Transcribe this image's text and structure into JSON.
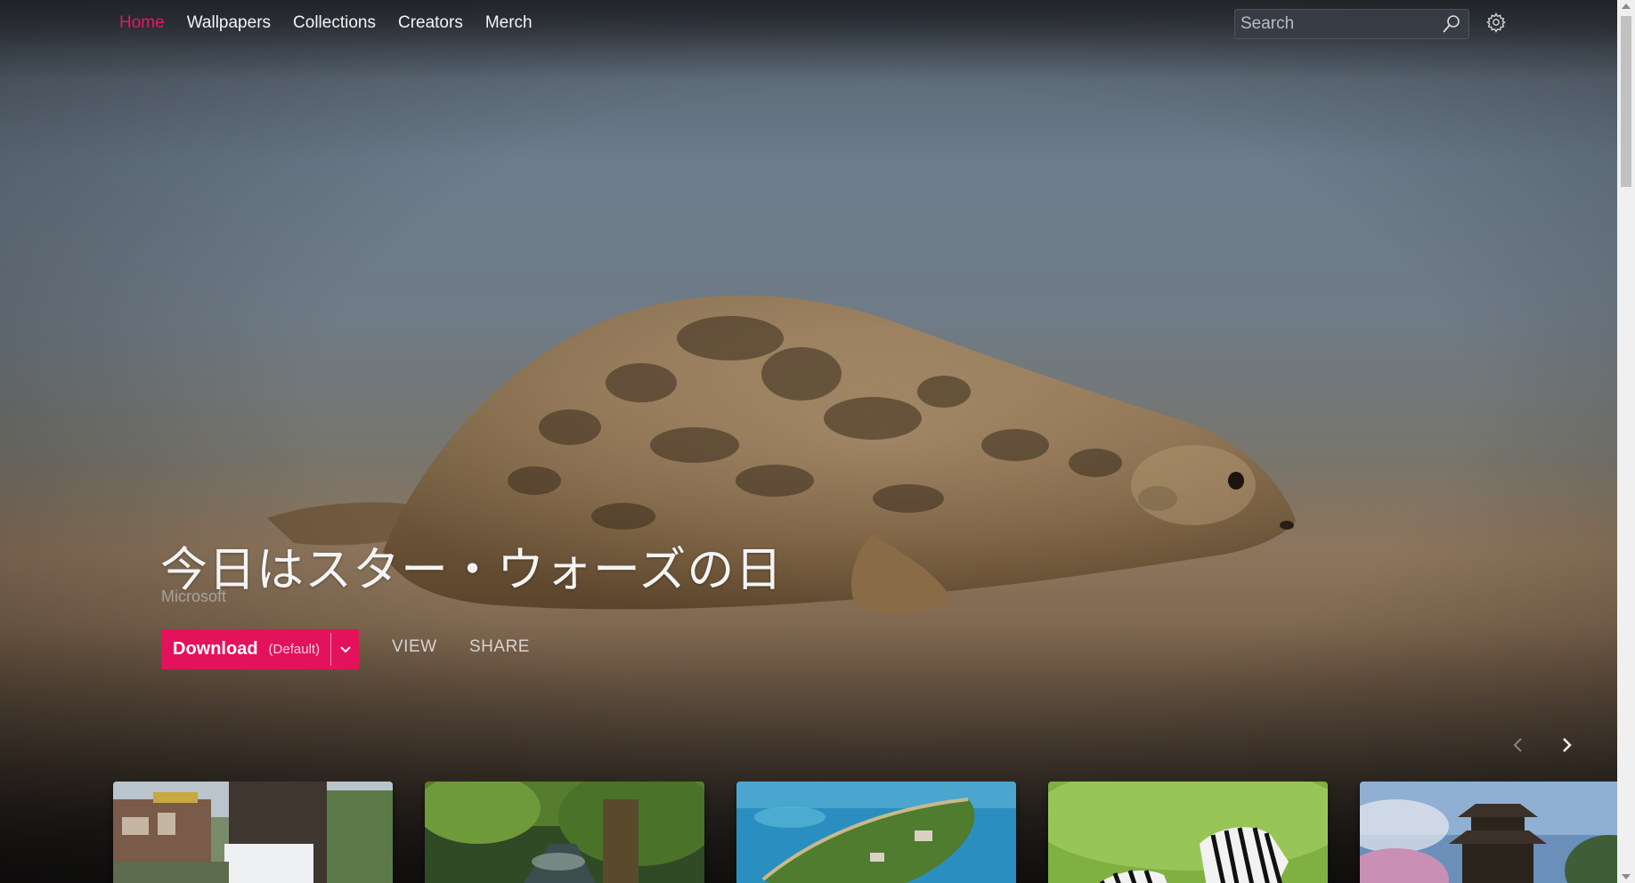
{
  "nav": {
    "items": [
      {
        "label": "Home",
        "active": true
      },
      {
        "label": "Wallpapers",
        "active": false
      },
      {
        "label": "Collections",
        "active": false
      },
      {
        "label": "Creators",
        "active": false
      },
      {
        "label": "Merch",
        "active": false
      }
    ]
  },
  "search": {
    "placeholder": "Search",
    "icon": "search-icon"
  },
  "settings": {
    "icon": "gear-icon"
  },
  "hero": {
    "title": "今日はスター・ウォーズの日",
    "credit": "Microsoft",
    "download_label": "Download",
    "download_sub": "(Default)",
    "view_label": "VIEW",
    "share_label": "SHARE"
  },
  "carousel": {
    "prev_icon": "chevron-left-icon",
    "next_icon": "chevron-right-icon"
  },
  "thumbnails": [
    {
      "subject": "tree with poster on campus"
    },
    {
      "subject": "mossy forest stream"
    },
    {
      "subject": "aerial island in turquoise water"
    },
    {
      "subject": "zebras on green background"
    },
    {
      "subject": "pagoda with cherry blossoms"
    }
  ],
  "colors": {
    "accent": "#e4125a",
    "active_nav": "#e8175d"
  }
}
